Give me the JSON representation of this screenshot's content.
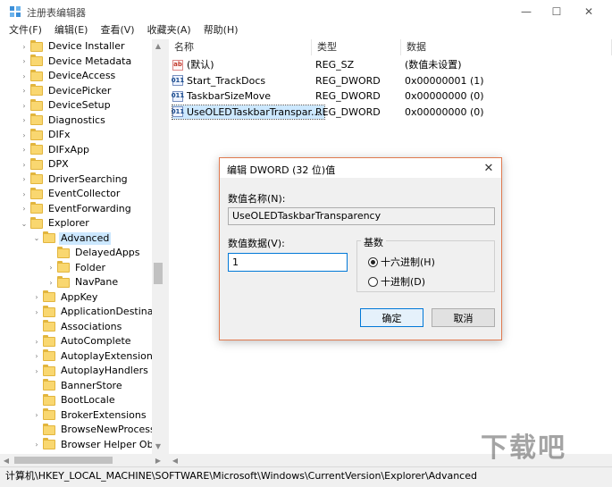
{
  "window": {
    "title": "注册表编辑器",
    "controls": {
      "minimize": "—",
      "maximize": "☐",
      "close": "✕"
    }
  },
  "menu": [
    "文件(F)",
    "编辑(E)",
    "查看(V)",
    "收藏夹(A)",
    "帮助(H)"
  ],
  "tree": {
    "items": [
      {
        "label": "Device Installer",
        "level": 0,
        "expander": "›"
      },
      {
        "label": "Device Metadata",
        "level": 0,
        "expander": "›"
      },
      {
        "label": "DeviceAccess",
        "level": 0,
        "expander": "›"
      },
      {
        "label": "DevicePicker",
        "level": 0,
        "expander": "›"
      },
      {
        "label": "DeviceSetup",
        "level": 0,
        "expander": "›"
      },
      {
        "label": "Diagnostics",
        "level": 0,
        "expander": "›"
      },
      {
        "label": "DIFx",
        "level": 0,
        "expander": "›"
      },
      {
        "label": "DIFxApp",
        "level": 0,
        "expander": "›"
      },
      {
        "label": "DPX",
        "level": 0,
        "expander": "›"
      },
      {
        "label": "DriverSearching",
        "level": 0,
        "expander": "›"
      },
      {
        "label": "EventCollector",
        "level": 0,
        "expander": "›"
      },
      {
        "label": "EventForwarding",
        "level": 0,
        "expander": "›"
      },
      {
        "label": "Explorer",
        "level": 0,
        "expander": "⌄"
      },
      {
        "label": "Advanced",
        "level": 1,
        "expander": "⌄",
        "selected": true
      },
      {
        "label": "DelayedApps",
        "level": 2,
        "expander": ""
      },
      {
        "label": "Folder",
        "level": 2,
        "expander": "›"
      },
      {
        "label": "NavPane",
        "level": 2,
        "expander": "›"
      },
      {
        "label": "AppKey",
        "level": 1,
        "expander": "›"
      },
      {
        "label": "ApplicationDestination",
        "level": 1,
        "expander": "›"
      },
      {
        "label": "Associations",
        "level": 1,
        "expander": ""
      },
      {
        "label": "AutoComplete",
        "level": 1,
        "expander": "›"
      },
      {
        "label": "AutoplayExtensions",
        "level": 1,
        "expander": "›"
      },
      {
        "label": "AutoplayHandlers",
        "level": 1,
        "expander": "›"
      },
      {
        "label": "BannerStore",
        "level": 1,
        "expander": ""
      },
      {
        "label": "BootLocale",
        "level": 1,
        "expander": ""
      },
      {
        "label": "BrokerExtensions",
        "level": 1,
        "expander": "›"
      },
      {
        "label": "BrowseNewProcess",
        "level": 1,
        "expander": ""
      },
      {
        "label": "Browser Helper Obje",
        "level": 1,
        "expander": "›"
      }
    ]
  },
  "values": {
    "columns": [
      "名称",
      "类型",
      "数据"
    ],
    "rows": [
      {
        "name": "(默认)",
        "type": "REG_SZ",
        "data": "(数值未设置)",
        "icon": "string-value-icon",
        "icon_text": "ab"
      },
      {
        "name": "Start_TrackDocs",
        "type": "REG_DWORD",
        "data": "0x00000001 (1)",
        "icon": "dword-value-icon",
        "icon_text": "011"
      },
      {
        "name": "TaskbarSizeMove",
        "type": "REG_DWORD",
        "data": "0x00000000 (0)",
        "icon": "dword-value-icon",
        "icon_text": "011"
      },
      {
        "name": "UseOLEDTaskbarTranspar...",
        "type": "REG_DWORD",
        "data": "0x00000000 (0)",
        "icon": "dword-value-icon",
        "icon_text": "011",
        "selected": true
      }
    ]
  },
  "status": {
    "path": "计算机\\HKEY_LOCAL_MACHINE\\SOFTWARE\\Microsoft\\Windows\\CurrentVersion\\Explorer\\Advanced"
  },
  "dialog": {
    "title": "编辑 DWORD (32 位)值",
    "close": "✕",
    "name_label": "数值名称(N):",
    "name_value": "UseOLEDTaskbarTransparency",
    "data_label": "数值数据(V):",
    "data_value": "1",
    "base_label": "基数",
    "radio_hex": "十六进制(H)",
    "radio_dec": "十进制(D)",
    "selected_base": "hex",
    "ok": "确定",
    "cancel": "取消"
  },
  "watermark": "下载吧",
  "colors": {
    "selection": "#cce8ff",
    "folder": "#f9d770",
    "dialog_border": "#e07a4f",
    "focus": "#0078d7"
  }
}
